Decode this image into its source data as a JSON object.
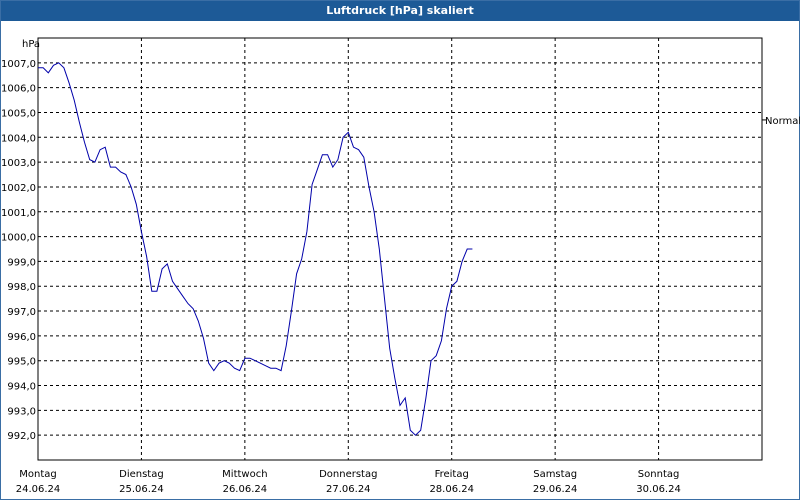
{
  "window": {
    "title": "Luftdruck [hPa] skaliert"
  },
  "chart_data": {
    "type": "line",
    "title": "Luftdruck [hPa] skaliert",
    "ylabel": "hPa",
    "ylim": [
      991.0,
      1008.0
    ],
    "yticks": [
      992,
      993,
      994,
      995,
      996,
      997,
      998,
      999,
      1000,
      1001,
      1002,
      1003,
      1004,
      1005,
      1006,
      1007
    ],
    "ytick_labels": [
      "992,0",
      "993,0",
      "994,0",
      "995,0",
      "996,0",
      "997,0",
      "998,0",
      "999,0",
      "1000,0",
      "1001,0",
      "1002,0",
      "1003,0",
      "1004,0",
      "1005,0",
      "1006,0",
      "1007,0"
    ],
    "xlim": [
      0,
      7
    ],
    "x_ticks": [
      {
        "day": "Montag",
        "date": "24.06.24"
      },
      {
        "day": "Dienstag",
        "date": "25.06.24"
      },
      {
        "day": "Mittwoch",
        "date": "26.06.24"
      },
      {
        "day": "Donnerstag",
        "date": "27.06.24"
      },
      {
        "day": "Freitag",
        "date": "28.06.24"
      },
      {
        "day": "Samstag",
        "date": "29.06.24"
      },
      {
        "day": "Sonntag",
        "date": "30.06.24"
      }
    ],
    "reference_line": {
      "label": "Normal",
      "value": 1004.7
    },
    "grid": true,
    "series_color": "#0000aa",
    "x": [
      0.0,
      0.05,
      0.1,
      0.15,
      0.2,
      0.25,
      0.3,
      0.35,
      0.4,
      0.45,
      0.5,
      0.55,
      0.6,
      0.65,
      0.7,
      0.75,
      0.8,
      0.85,
      0.9,
      0.95,
      1.0,
      1.05,
      1.1,
      1.15,
      1.2,
      1.25,
      1.3,
      1.35,
      1.4,
      1.45,
      1.5,
      1.55,
      1.6,
      1.65,
      1.7,
      1.75,
      1.8,
      1.85,
      1.9,
      1.95,
      2.0,
      2.05,
      2.1,
      2.15,
      2.2,
      2.25,
      2.3,
      2.35,
      2.4,
      2.45,
      2.5,
      2.55,
      2.6,
      2.65,
      2.7,
      2.75,
      2.8,
      2.85,
      2.9,
      2.95,
      3.0,
      3.05,
      3.1,
      3.15,
      3.2,
      3.25,
      3.3,
      3.35,
      3.4,
      3.45,
      3.5,
      3.55,
      3.6,
      3.65,
      3.7,
      3.75,
      3.8,
      3.85,
      3.9,
      3.95,
      4.0,
      4.05,
      4.1,
      4.15,
      4.2,
      4.25,
      4.3,
      4.35,
      4.4,
      4.45,
      4.5,
      4.55,
      4.6,
      4.65,
      4.7,
      4.75,
      4.8,
      4.85,
      4.9,
      4.95,
      5.0,
      5.05,
      5.1,
      5.15,
      5.2,
      5.25,
      5.3,
      5.35,
      5.4,
      5.45,
      5.5,
      5.55,
      5.6,
      5.65,
      5.7,
      5.75,
      5.8,
      5.85,
      5.9,
      5.95,
      6.0,
      6.05,
      6.1,
      6.15,
      6.2,
      6.25,
      6.3,
      6.35,
      6.4,
      6.45,
      6.5,
      6.55,
      6.6,
      6.65,
      6.7,
      6.75,
      6.8,
      6.85,
      6.9,
      6.95,
      7.0
    ],
    "y": [
      1006.8,
      1006.8,
      1006.6,
      1006.9,
      1007.0,
      1006.8,
      1006.2,
      1005.5,
      1004.6,
      1003.8,
      1003.1,
      1003.0,
      1003.5,
      1003.6,
      1002.8,
      1002.8,
      1002.6,
      1002.5,
      1002.0,
      1001.3,
      1000.2,
      999.2,
      997.8,
      997.8,
      998.7,
      998.9,
      998.2,
      997.9,
      997.6,
      997.3,
      997.1,
      996.6,
      995.9,
      994.9,
      994.6,
      994.9,
      995.0,
      994.9,
      994.7,
      994.6,
      995.1,
      995.1,
      995.0,
      994.9,
      994.8,
      994.7,
      994.7,
      994.6,
      995.6,
      997.0,
      998.5,
      999.1,
      1000.2,
      1002.1,
      1002.7,
      1003.3,
      1003.3,
      1002.8,
      1003.1,
      1004.0,
      1004.2,
      1003.6,
      1003.5,
      1003.2,
      1002.0,
      1001.0,
      999.5,
      997.5,
      995.5,
      994.3,
      993.2,
      993.5,
      992.2,
      992.0,
      992.2,
      993.5,
      995.0,
      995.2,
      995.8,
      997.1,
      998.0,
      998.2,
      999.0,
      999.5,
      999.5
    ]
  }
}
